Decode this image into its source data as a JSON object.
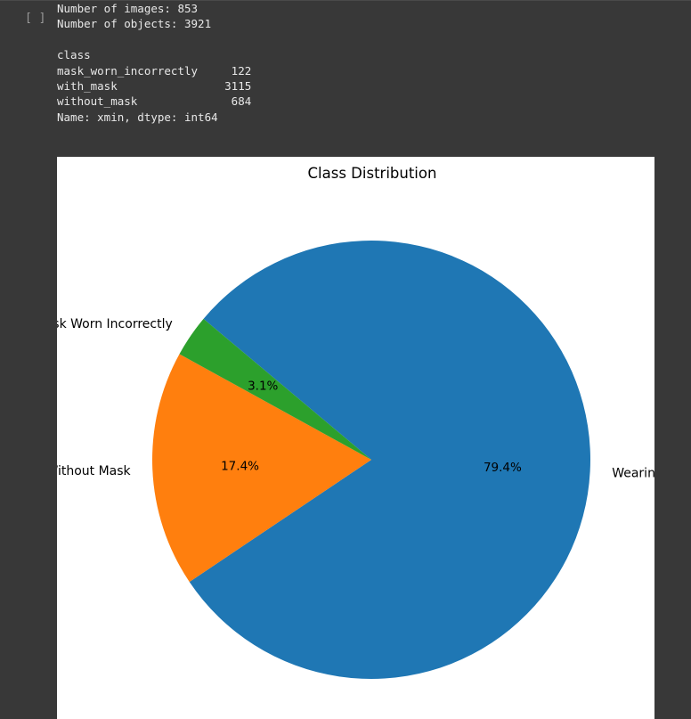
{
  "cell": {
    "run_label": "[ ]"
  },
  "output": {
    "lines": [
      "Number of images: 853",
      "Number of objects: 3921",
      "",
      "class",
      "mask_worn_incorrectly     122",
      "with_mask                3115",
      "without_mask              684",
      "Name: xmin, dtype: int64"
    ]
  },
  "chart_data": {
    "type": "pie",
    "title": "Class Distribution",
    "start_angle_deg": 140,
    "slices": [
      {
        "label": "Wearing Mask",
        "value": 79.4,
        "pct_label": "79.4%",
        "color": "#1f77b4"
      },
      {
        "label": "Without Mask",
        "value": 17.4,
        "pct_label": "17.4%",
        "color": "#ff7f0e"
      },
      {
        "label": "Mask Worn Incorrectly",
        "value": 3.1,
        "pct_label": "3.1%",
        "color": "#2ca02c"
      }
    ]
  }
}
